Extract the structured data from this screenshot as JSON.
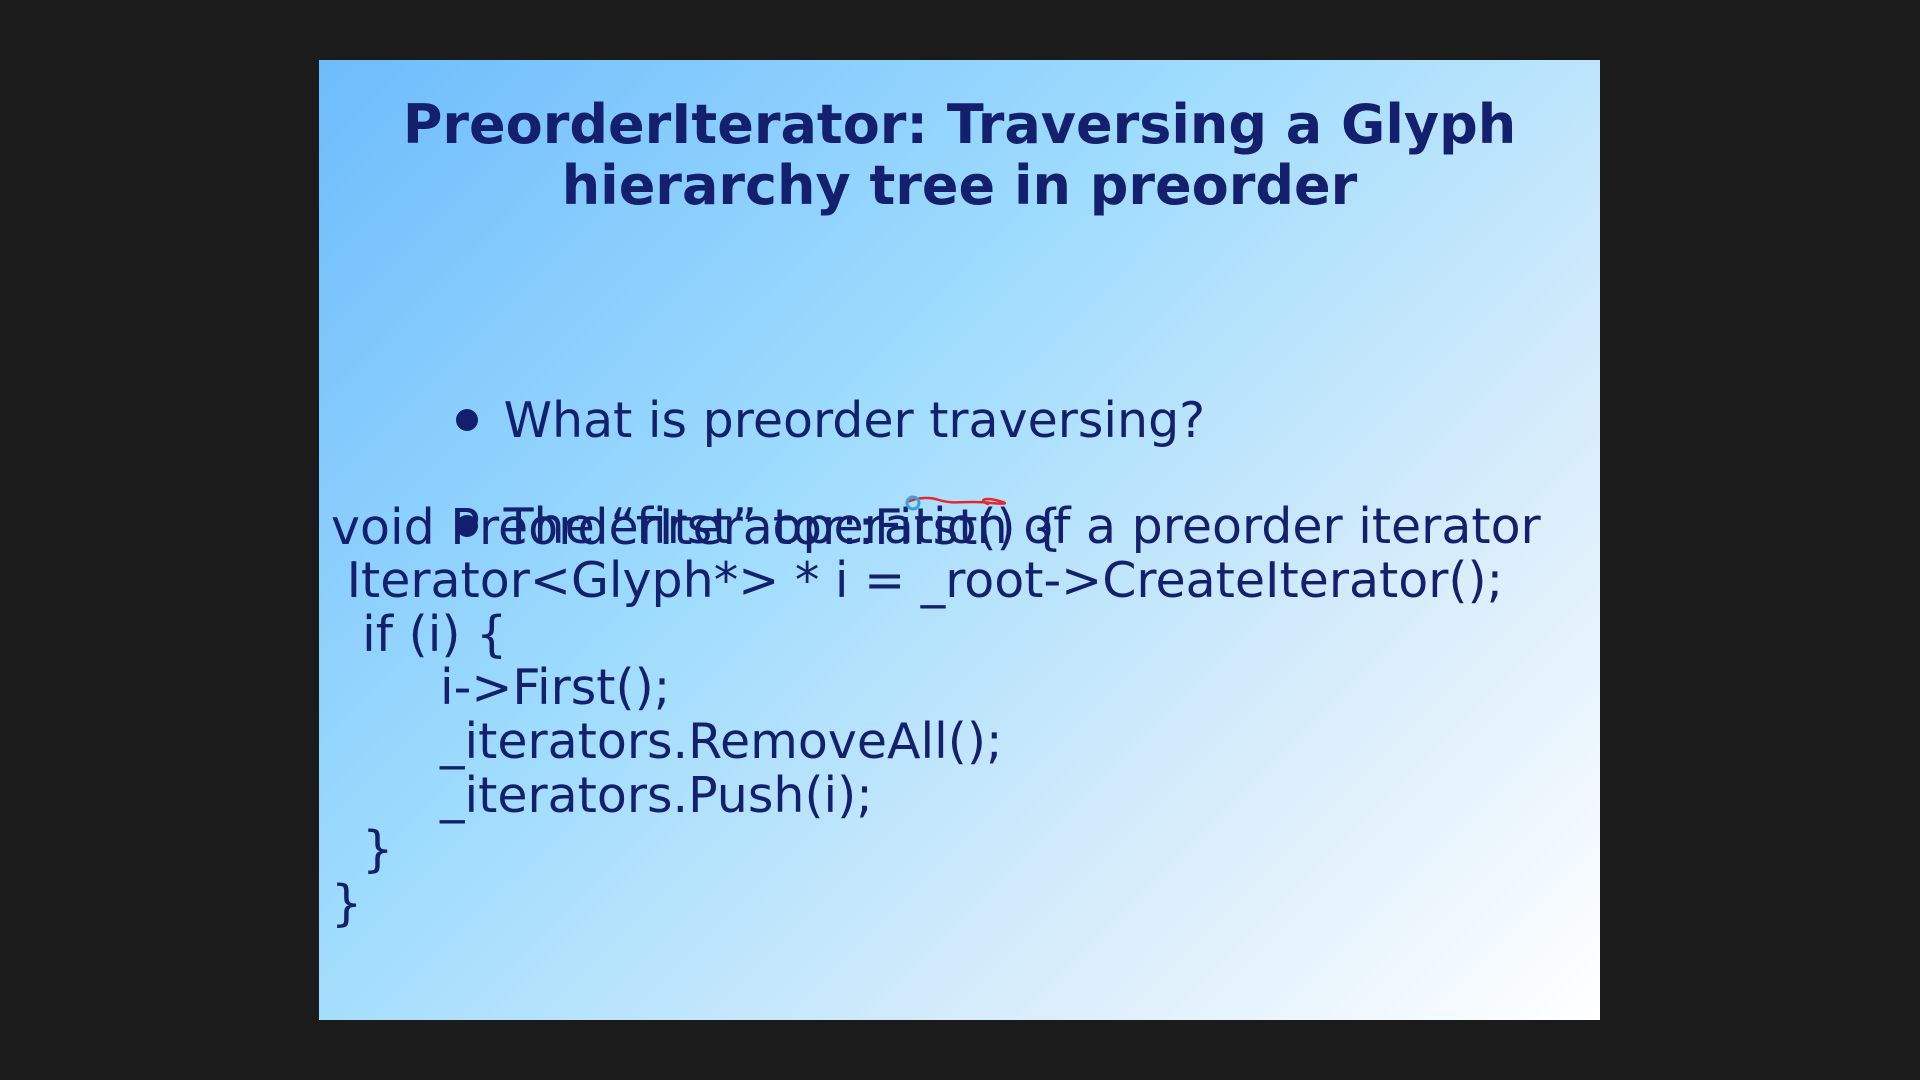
{
  "slide": {
    "title_line1": "PreorderIterator: Traversing a Glyph",
    "title_line2": "hierarchy tree in preorder",
    "bullets": [
      "What is preorder traversing?",
      "The “first” operation of a preorder iterator"
    ],
    "code": [
      "void PreorderIterator::First() {",
      " Iterator<Glyph*> * i = _root->CreateIterator();",
      "  if (i) {",
      "       i->First();",
      "       _iterators.RemoveAll();",
      "       _iterators.Push(i);",
      "  }",
      "}"
    ]
  },
  "annotation": {
    "pen_color": "#e8262f",
    "cursor_color": "#3aa0e0",
    "cursor_icon": "pen-cursor-icon"
  }
}
